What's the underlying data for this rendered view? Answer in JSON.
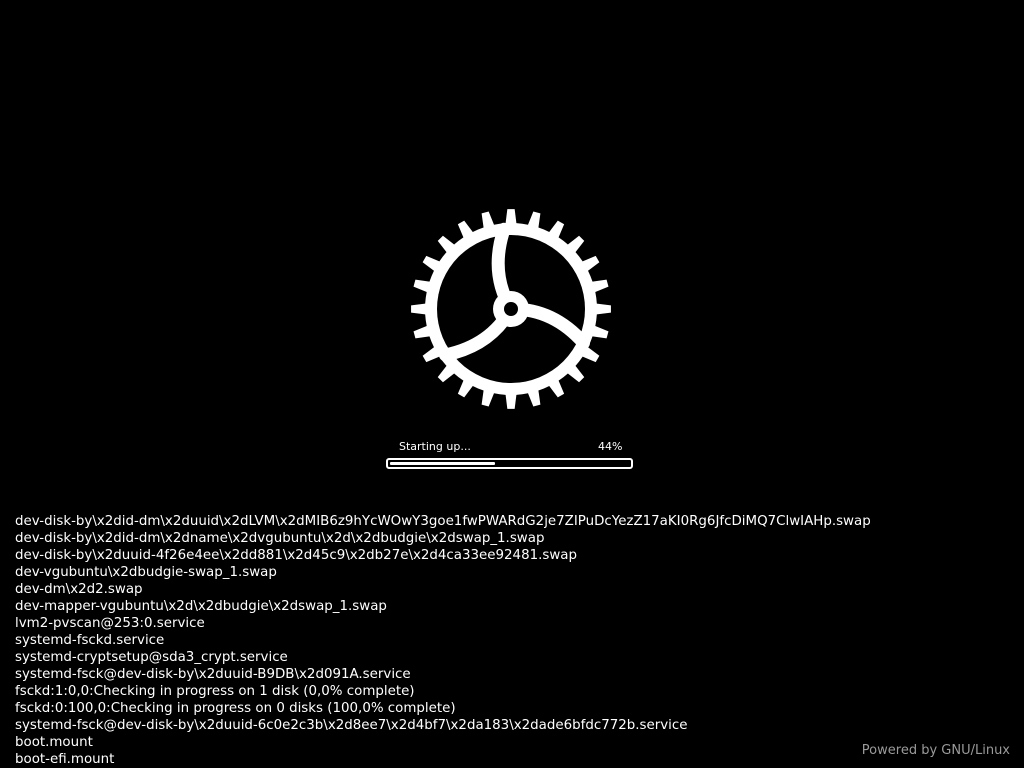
{
  "splash": {
    "logo_icon": "gear-icon",
    "status": "Starting up...",
    "progress_label": "44%",
    "progress": 0.44
  },
  "colors": {
    "background": "#000000",
    "foreground": "#ffffff",
    "footer_text": "#9a9a9a"
  },
  "log_lines": [
    "dev-disk-by\\x2did-dm\\x2duuid\\x2dLVM\\x2dMIB6z9hYcWOwY3goe1fwPWARdG2je7ZIPuDcYezZ17aKI0Rg6JfcDiMQ7ClwIAHp.swap",
    "dev-disk-by\\x2did-dm\\x2dname\\x2dvgubuntu\\x2d\\x2dbudgie\\x2dswap_1.swap",
    "dev-disk-by\\x2duuid-4f26e4ee\\x2dd881\\x2d45c9\\x2db27e\\x2d4ca33ee92481.swap",
    "dev-vgubuntu\\x2dbudgie-swap_1.swap",
    "dev-dm\\x2d2.swap",
    "dev-mapper-vgubuntu\\x2d\\x2dbudgie\\x2dswap_1.swap",
    "lvm2-pvscan@253:0.service",
    "systemd-fsckd.service",
    "systemd-cryptsetup@sda3_crypt.service",
    "systemd-fsck@dev-disk-by\\x2duuid-B9DB\\x2d091A.service",
    "fsckd:1:0,0:Checking in progress on 1 disk (0,0% complete)",
    "fsckd:0:100,0:Checking in progress on 0 disks (100,0% complete)",
    "systemd-fsck@dev-disk-by\\x2duuid-6c0e2c3b\\x2d8ee7\\x2d4bf7\\x2da183\\x2dade6bfdc772b.service",
    "boot.mount",
    "boot-efi.mount"
  ],
  "footer": {
    "text": "Powered by GNU/Linux"
  }
}
